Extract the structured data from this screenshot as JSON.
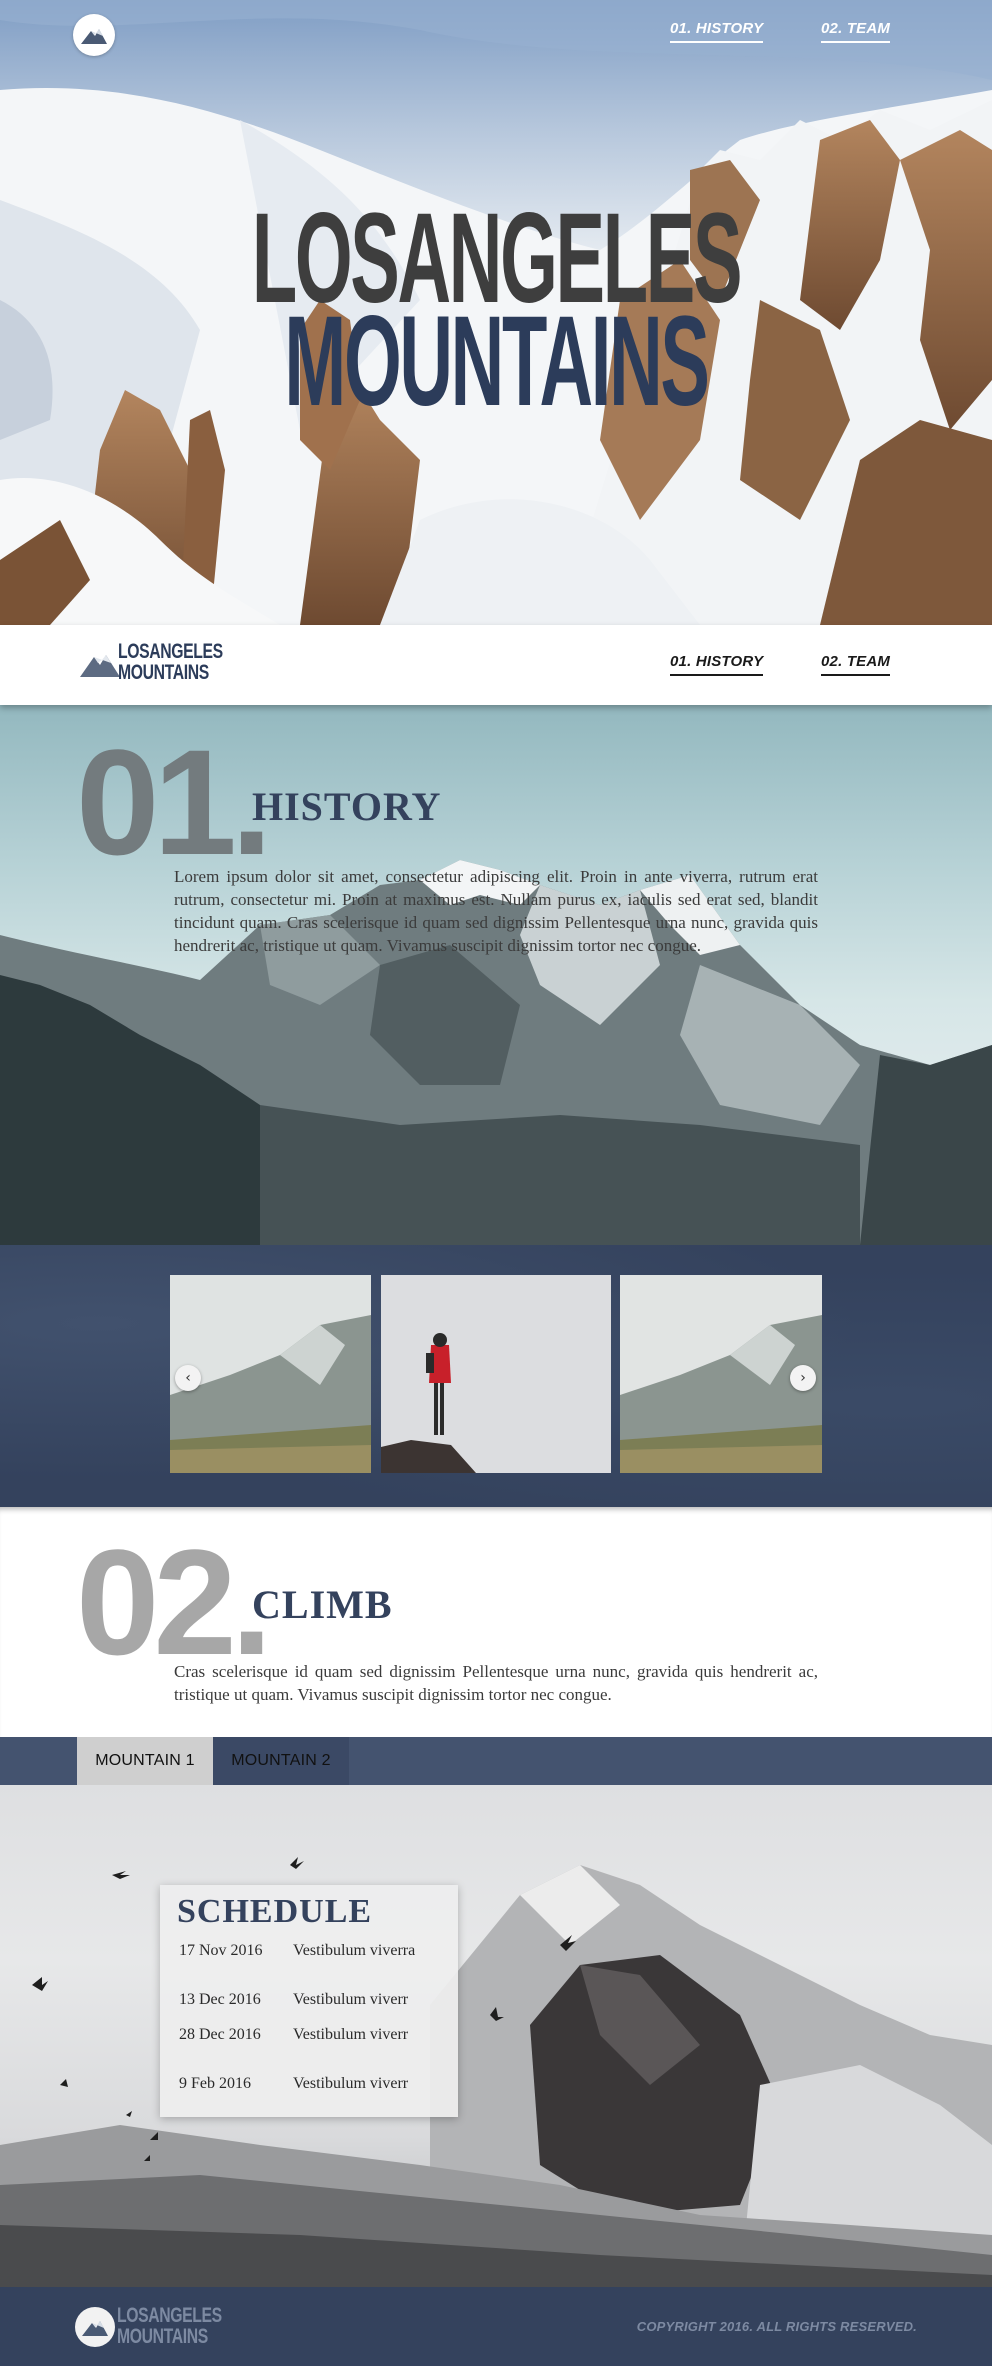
{
  "brand": {
    "line1": "LOSANGELES",
    "line2": "MOUNTAINS"
  },
  "nav": {
    "history": "01. HISTORY",
    "team": "02. TEAM"
  },
  "hero": {
    "title_line1": "LOSANGELES",
    "title_line2": "MOUNTAINS"
  },
  "history": {
    "number": "01.",
    "title": "HISTORY",
    "text": "Lorem ipsum dolor sit amet, consectetur adipiscing elit. Proin in ante viverra, rutrum erat rutrum, consectetur mi. Proin at maximus est. Nullam purus ex, iaculis sed erat sed, blandit tincidunt quam. Cras scelerisque id quam sed dignissim Pellentesque urna nunc, gravida quis hendrerit ac, tristique ut quam. Vivamus suscipit dignissim tortor nec congue."
  },
  "gallery": {
    "prev": "‹",
    "next": "›"
  },
  "climb": {
    "number": "02.",
    "title": "CLIMB",
    "text": "Cras scelerisque id quam sed dignissim Pellentesque urna nunc, gravida quis hendrerit ac, tristique ut quam. Vivamus suscipit dignissim tortor nec congue."
  },
  "tabs": [
    {
      "label": "MOUNTAIN 1",
      "active": true
    },
    {
      "label": "MOUNTAIN 2",
      "active": false
    }
  ],
  "schedule": {
    "title": "SCHEDULE",
    "rows": [
      {
        "date": "17 Nov 2016",
        "event": "Vestibulum viverra"
      },
      {
        "date": "13 Dec 2016",
        "event": "Vestibulum viverr"
      },
      {
        "date": "28 Dec 2016",
        "event": "Vestibulum viverr"
      },
      {
        "date": "9 Feb 2016",
        "event": "Vestibulum viverr"
      }
    ]
  },
  "footer": {
    "copyright": "COPYRIGHT 2016.  ALL RIGHTS RESERVED."
  },
  "colors": {
    "navy": "#34425d",
    "dark_title": "#3e3e3e",
    "number_gray": "#7a7f80",
    "tab_active": "#cfcfcf"
  }
}
